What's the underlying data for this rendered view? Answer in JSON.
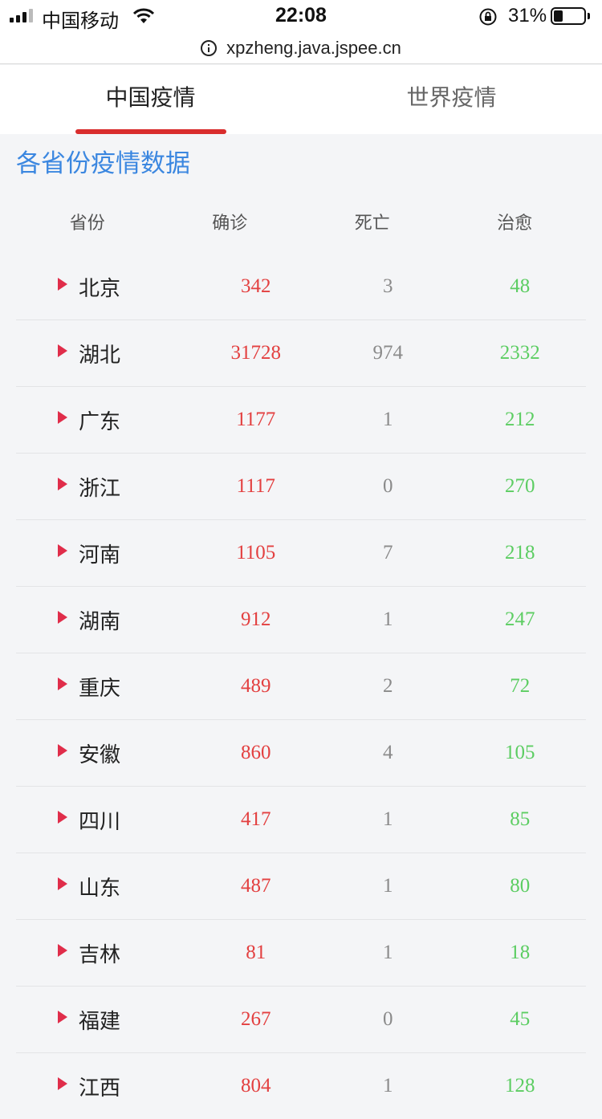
{
  "status_bar": {
    "carrier": "中国移动",
    "time": "22:08",
    "battery_percent": "31%",
    "battery_level": 0.31
  },
  "url_bar": {
    "url": "xpzheng.java.jspee.cn"
  },
  "tabs": [
    {
      "label": "中国疫情",
      "active": true
    },
    {
      "label": "世界疫情",
      "active": false
    }
  ],
  "section_title": "各省份疫情数据",
  "table": {
    "headers": [
      "省份",
      "确诊",
      "死亡",
      "治愈"
    ],
    "rows": [
      {
        "province": "北京",
        "confirmed": "342",
        "deaths": "3",
        "cured": "48"
      },
      {
        "province": "湖北",
        "confirmed": "31728",
        "deaths": "974",
        "cured": "2332"
      },
      {
        "province": "广东",
        "confirmed": "1177",
        "deaths": "1",
        "cured": "212"
      },
      {
        "province": "浙江",
        "confirmed": "1117",
        "deaths": "0",
        "cured": "270"
      },
      {
        "province": "河南",
        "confirmed": "1105",
        "deaths": "7",
        "cured": "218"
      },
      {
        "province": "湖南",
        "confirmed": "912",
        "deaths": "1",
        "cured": "247"
      },
      {
        "province": "重庆",
        "confirmed": "489",
        "deaths": "2",
        "cured": "72"
      },
      {
        "province": "安徽",
        "confirmed": "860",
        "deaths": "4",
        "cured": "105"
      },
      {
        "province": "四川",
        "confirmed": "417",
        "deaths": "1",
        "cured": "85"
      },
      {
        "province": "山东",
        "confirmed": "487",
        "deaths": "1",
        "cured": "80"
      },
      {
        "province": "吉林",
        "confirmed": "81",
        "deaths": "1",
        "cured": "18"
      },
      {
        "province": "福建",
        "confirmed": "267",
        "deaths": "0",
        "cured": "45"
      },
      {
        "province": "江西",
        "confirmed": "804",
        "deaths": "1",
        "cured": "128"
      }
    ]
  },
  "colors": {
    "tab_indicator": "#d92d2d",
    "section_title": "#3b87e0",
    "confirmed": "#e34040",
    "deaths": "#8a8a8a",
    "cured": "#5ccd62",
    "expand_arrow": "#e02d4a"
  }
}
